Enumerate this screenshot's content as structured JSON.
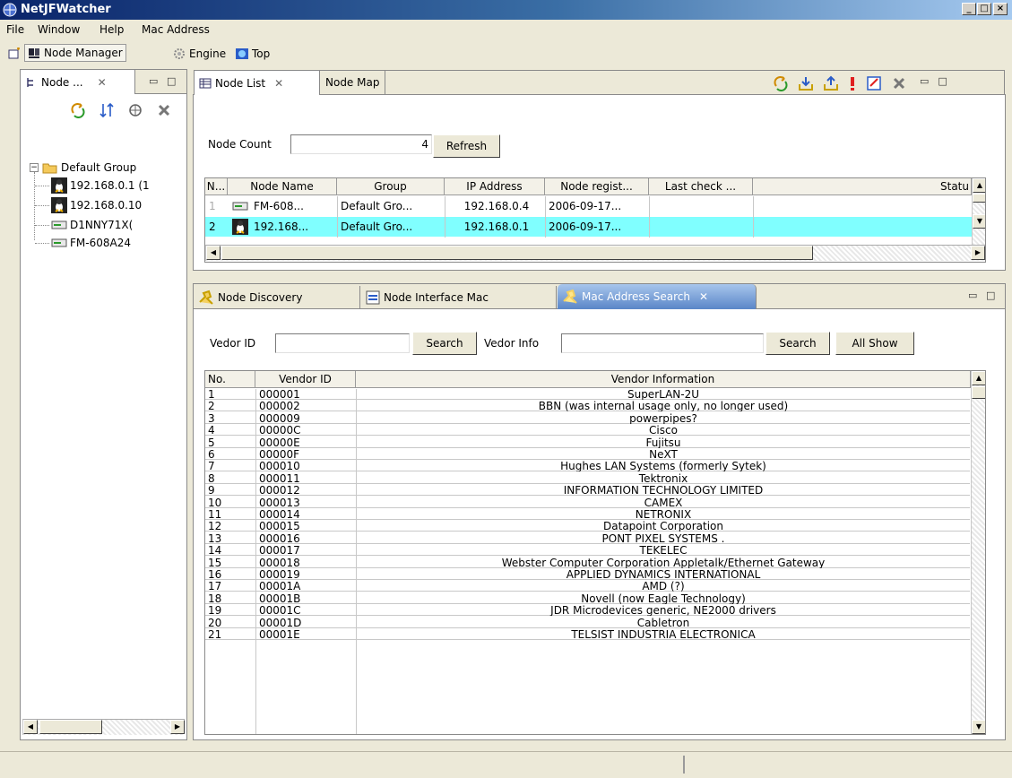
{
  "window": {
    "title": "NetJFWatcher",
    "min": "_",
    "max": "□",
    "close": "×"
  },
  "menu": [
    "File",
    "Window",
    "Help",
    "Mac Address"
  ],
  "perspectives": [
    "Node Manager",
    "Engine",
    "Top"
  ],
  "node_tree": {
    "tab_label": "Node ...",
    "group": "Default Group",
    "items": [
      "192.168.0.1 (1",
      "192.168.0.10",
      "D1NNY71X(",
      "FM-608A24"
    ]
  },
  "node_list": {
    "tabs": [
      "Node List",
      "Node Map"
    ],
    "count_label": "Node Count",
    "count_value": "4",
    "refresh_label": "Refresh",
    "columns": [
      "N...",
      "Node Name",
      "Group",
      "IP Address",
      "Node regist...",
      "Last check ...",
      "Statu"
    ],
    "rows": [
      {
        "no": "1",
        "name": "FM-608...",
        "group": "Default Gro...",
        "ip": "192.168.0.4",
        "reg": "2006-09-17...",
        "check": ""
      },
      {
        "no": "2",
        "name": "192.168...",
        "group": "Default Gro...",
        "ip": "192.168.0.1",
        "reg": "2006-09-17...",
        "check": ""
      }
    ]
  },
  "bottom_tabs": [
    "Node Discovery",
    "Node Interface Mac",
    "Mac Address Search"
  ],
  "search": {
    "vendor_id_label": "Vedor ID",
    "vendor_info_label": "Vedor Info",
    "search_label": "Search",
    "all_show_label": "All Show",
    "vendor_id_value": "",
    "vendor_info_value": ""
  },
  "vendor_columns": [
    "No.",
    "Vendor ID",
    "Vendor Information"
  ],
  "vendors": [
    [
      "1",
      "000001",
      "SuperLAN-2U"
    ],
    [
      "2",
      "000002",
      "BBN (was internal usage only, no longer used)"
    ],
    [
      "3",
      "000009",
      "powerpipes?"
    ],
    [
      "4",
      "00000C",
      "Cisco"
    ],
    [
      "5",
      "00000E",
      "Fujitsu"
    ],
    [
      "6",
      "00000F",
      "NeXT"
    ],
    [
      "7",
      "000010",
      "Hughes LAN Systems (formerly Sytek)"
    ],
    [
      "8",
      "000011",
      "Tektronix"
    ],
    [
      "9",
      "000012",
      "INFORMATION TECHNOLOGY LIMITED"
    ],
    [
      "10",
      "000013",
      "CAMEX"
    ],
    [
      "11",
      "000014",
      "NETRONIX"
    ],
    [
      "12",
      "000015",
      "Datapoint Corporation"
    ],
    [
      "13",
      "000016",
      "PONT PIXEL SYSTEMS ."
    ],
    [
      "14",
      "000017",
      "TEKELEC"
    ],
    [
      "15",
      "000018",
      "Webster Computer Corporation Appletalk/Ethernet Gateway"
    ],
    [
      "16",
      "000019",
      "APPLIED DYNAMICS INTERNATIONAL"
    ],
    [
      "17",
      "00001A",
      "AMD (?)"
    ],
    [
      "18",
      "00001B",
      "Novell (now Eagle Technology)"
    ],
    [
      "19",
      "00001C",
      "JDR Microdevices generic, NE2000 drivers"
    ],
    [
      "20",
      "00001D",
      "Cabletron"
    ],
    [
      "21",
      "00001E",
      "TELSIST INDUSTRIA ELECTRONICA"
    ]
  ],
  "colors": {
    "title_start": "#0a246a",
    "selected_row": "#80ffff",
    "tab_highlight": "#5a86c8"
  }
}
